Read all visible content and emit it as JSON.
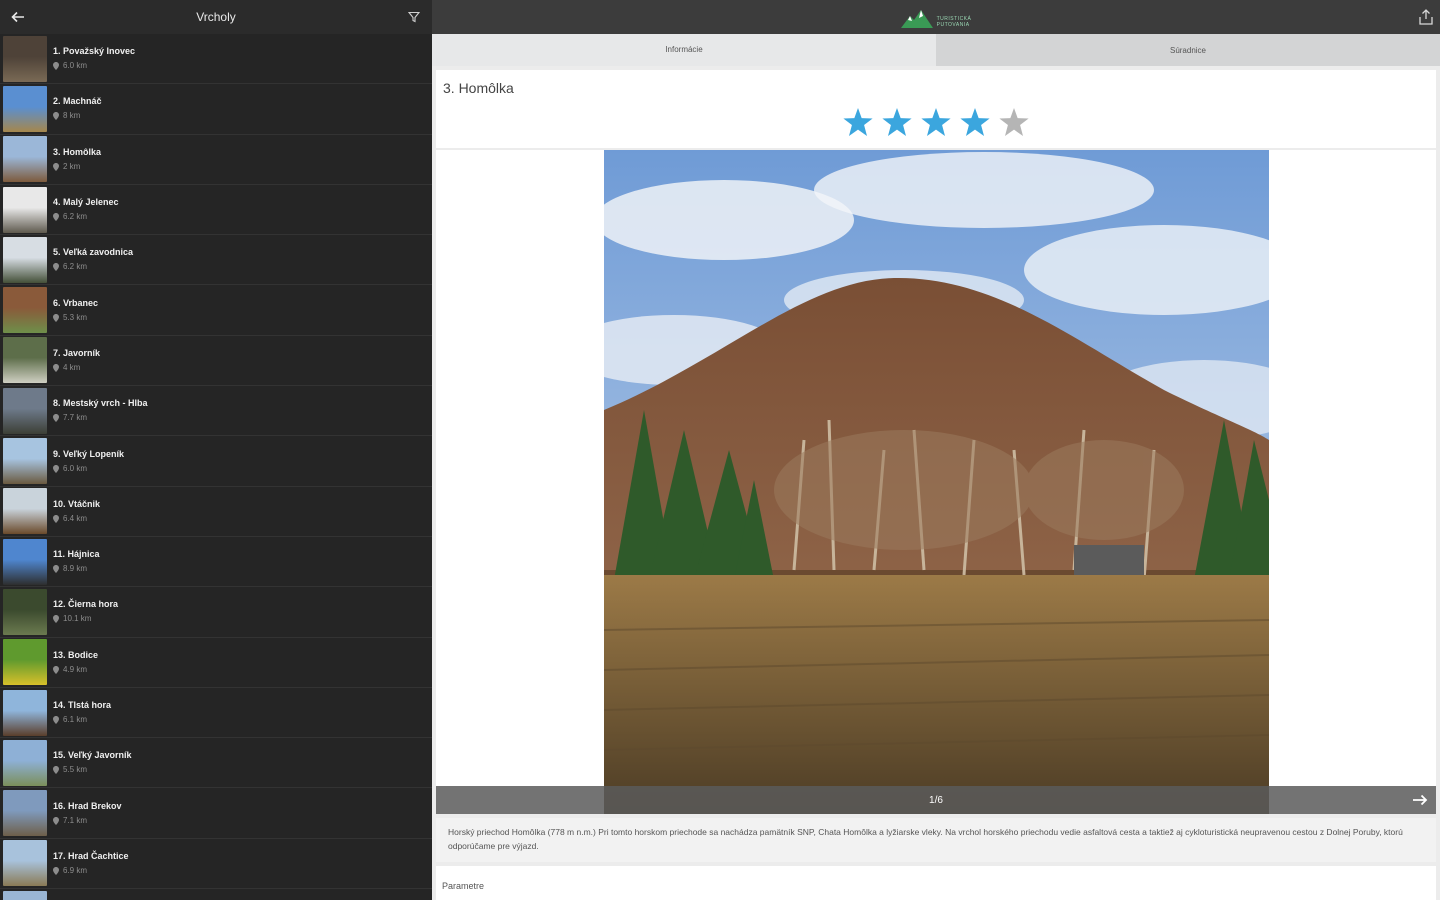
{
  "sidebar": {
    "title": "Vrcholy",
    "items": [
      {
        "name": "1. Považský Inovec",
        "distance": "6.0 km",
        "thumb": [
          "#4e4238",
          "#7a6a55"
        ]
      },
      {
        "name": "2. Machnáč",
        "distance": "8 km",
        "thumb": [
          "#5a8fd1",
          "#a6874c"
        ]
      },
      {
        "name": "3. Homôlka",
        "distance": "2 km",
        "thumb": [
          "#9bb7d8",
          "#7d5a3c"
        ]
      },
      {
        "name": "4. Malý Jelenec",
        "distance": "6.2 km",
        "thumb": [
          "#e8e8e8",
          "#5f5a4e"
        ]
      },
      {
        "name": "5. Veľká zavodnica",
        "distance": "6.2 km",
        "thumb": [
          "#d7dde3",
          "#445038"
        ]
      },
      {
        "name": "6. Vrbanec",
        "distance": "5.3 km",
        "thumb": [
          "#8a5a3a",
          "#6e8f4a"
        ]
      },
      {
        "name": "7. Javorník",
        "distance": "4 km",
        "thumb": [
          "#5d6e4a",
          "#cfcfc2"
        ]
      },
      {
        "name": "8. Mestský vrch - Hlba",
        "distance": "7.7 km",
        "thumb": [
          "#6e7a8a",
          "#3c3f36"
        ]
      },
      {
        "name": "9. Veľký Lopeník",
        "distance": "6.0 km",
        "thumb": [
          "#a7c4e0",
          "#6a5a40"
        ]
      },
      {
        "name": "10. Vtáčnik",
        "distance": "6.4 km",
        "thumb": [
          "#c9d3db",
          "#6a4a2a"
        ]
      },
      {
        "name": "11. Hájnica",
        "distance": "8.9 km",
        "thumb": [
          "#4f86cf",
          "#2e2e2e"
        ]
      },
      {
        "name": "12. Čierna hora",
        "distance": "10.1 km",
        "thumb": [
          "#3b4a2e",
          "#6b7a4f"
        ]
      },
      {
        "name": "13. Bodice",
        "distance": "4.9 km",
        "thumb": [
          "#5f9a2e",
          "#d8c02a"
        ]
      },
      {
        "name": "14. Tlstá hora",
        "distance": "6.1 km",
        "thumb": [
          "#8fb5db",
          "#5a3e2a"
        ]
      },
      {
        "name": "15. Veľký Javorník",
        "distance": "5.5 km",
        "thumb": [
          "#8eb0d6",
          "#7b8f5a"
        ]
      },
      {
        "name": "16. Hrad Brekov",
        "distance": "7.1 km",
        "thumb": [
          "#7f9abd",
          "#6e5f4a"
        ]
      },
      {
        "name": "17. Hrad Čachtice",
        "distance": "6.9 km",
        "thumb": [
          "#a8c2dc",
          "#8a7a55"
        ]
      },
      {
        "name": "",
        "distance": "",
        "thumb": [
          "#9ab6d5",
          "#4f4a3a"
        ]
      }
    ]
  },
  "header": {
    "logo_text": "TURISTICKÁ\nPUTOVANIA"
  },
  "tabs": [
    {
      "label": "Informácie",
      "active": true
    },
    {
      "label": "Súradnice",
      "active": false
    }
  ],
  "detail": {
    "title": "3. Homôlka",
    "rating": 4,
    "max_rating": 5,
    "star_color": "#3ba6de",
    "star_empty_color": "#b5b5b5",
    "photo_counter": "1/6",
    "description": "Horský priechod Homôlka (778 m n.m.) Pri tomto horskom priechode sa nachádza pamätník SNP, Chata Homôlka a lyžiarske vleky. Na vrchol horského priechodu vedie asfaltová cesta a taktiež aj cykloturistická neupravenou cestou z Dolnej Poruby, ktorú odporúčame pre výjazd.",
    "params_label": "Parametre"
  }
}
